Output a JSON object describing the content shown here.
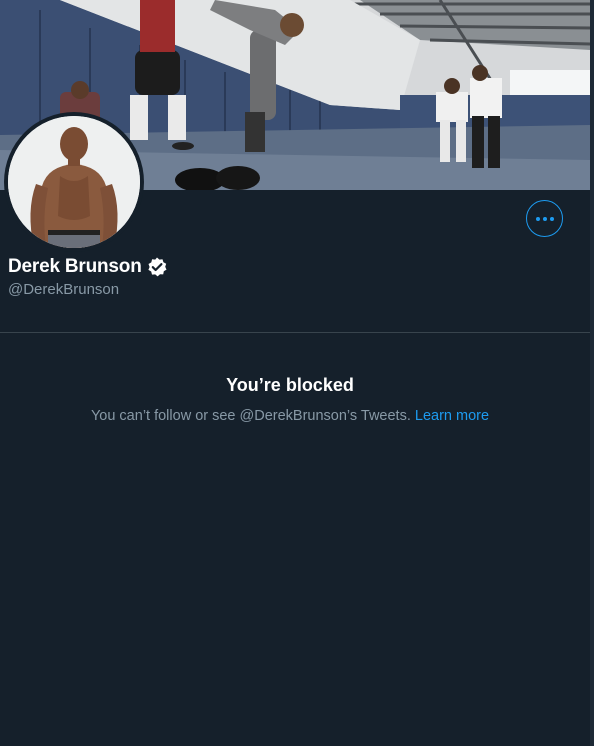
{
  "profile": {
    "display_name": "Derek Brunson",
    "handle": "@DerekBrunson",
    "verified": true
  },
  "actions": {
    "more_button": "more-options"
  },
  "blocked": {
    "title": "You’re blocked",
    "description": "You can’t follow or see @DerekBrunson’s Tweets.",
    "link_text": "Learn more"
  },
  "colors": {
    "background": "#15202b",
    "accent": "#1d9bf0",
    "secondary_text": "#8899a6",
    "divider": "#38444d"
  },
  "icons": {
    "verified": "verified-badge-icon",
    "more": "more-dots-icon"
  }
}
